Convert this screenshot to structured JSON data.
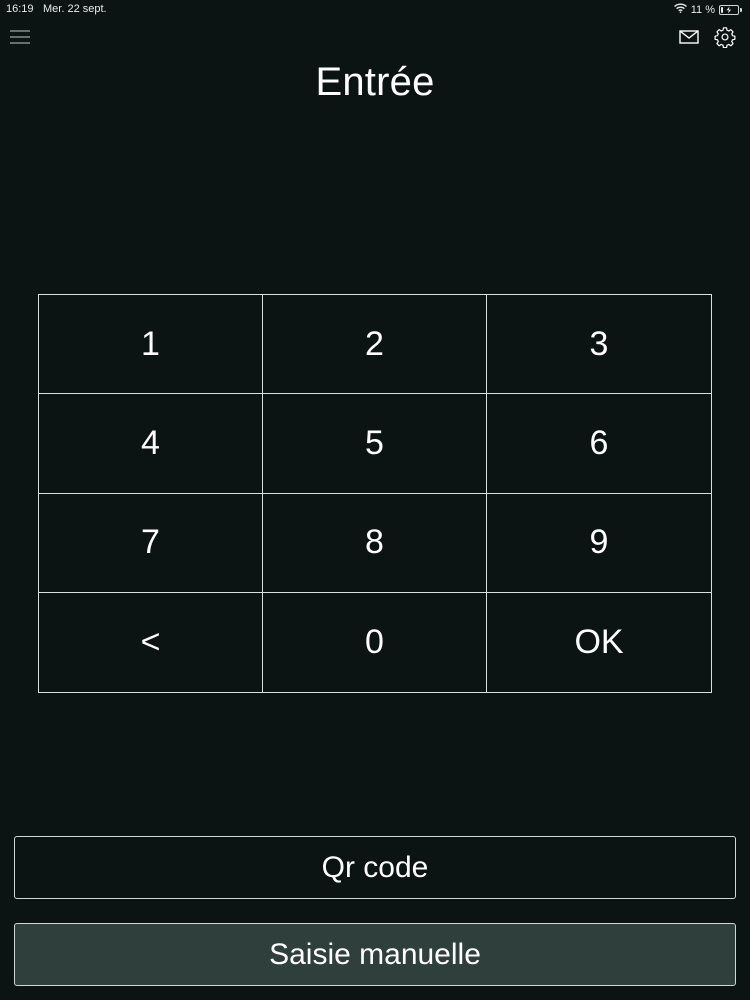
{
  "status_bar": {
    "time": "16:19",
    "date": "Mer. 22 sept.",
    "battery_text": "11 %",
    "battery_level": 0.11
  },
  "header": {
    "menu_icon": "hamburger-menu-icon",
    "mail_icon": "mail-icon",
    "settings_icon": "gear-icon"
  },
  "page": {
    "title": "Entrée"
  },
  "keypad": {
    "keys": [
      "1",
      "2",
      "3",
      "4",
      "5",
      "6",
      "7",
      "8",
      "9",
      "<",
      "0",
      "OK"
    ]
  },
  "actions": {
    "qr_label": "Qr code",
    "manual_label": "Saisie manuelle"
  },
  "colors": {
    "background": "#0b1412",
    "manual_button_bg": "#2e3f3c",
    "border": "#d9dfdd"
  }
}
